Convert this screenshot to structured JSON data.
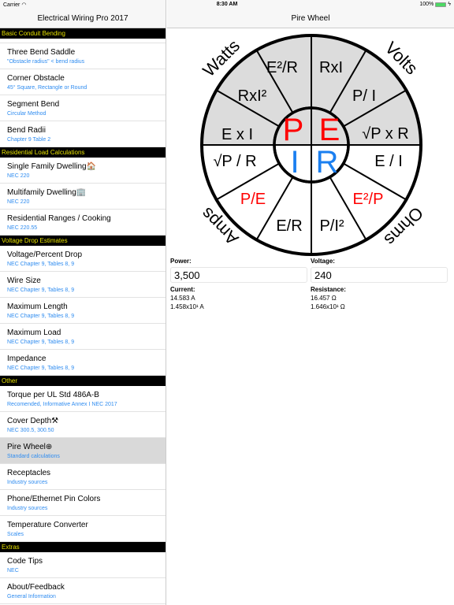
{
  "status": {
    "carrier": "Carrier",
    "time": "8:30 AM",
    "battery": "100%",
    "battery_level": 1.0
  },
  "master": {
    "title": "Electrical Wiring Pro 2017",
    "sections": [
      {
        "header": "Basic Conduit Bending",
        "items": [
          {
            "title": "Three Bend Saddle",
            "subtitle": "\"Obstacle radius\" < bend radius"
          },
          {
            "title": "Corner Obstacle",
            "subtitle": "45° Square, Rectangle or Round"
          },
          {
            "title": "Segment Bend",
            "subtitle": "Circular Method"
          },
          {
            "title": "Bend Radii",
            "subtitle": "Chapter 9 Table 2"
          }
        ]
      },
      {
        "header": "Residential Load Calculations",
        "items": [
          {
            "title": "Single Family Dwelling🏠",
            "subtitle": "NEC 220"
          },
          {
            "title": "Multifamily Dwelling🏢",
            "subtitle": "NEC 220"
          },
          {
            "title": "Residential Ranges / Cooking",
            "subtitle": "NEC 220.55"
          }
        ]
      },
      {
        "header": "Voltage Drop Estimates",
        "items": [
          {
            "title": "Voltage/Percent Drop",
            "subtitle": "NEC Chapter 9, Tables 8, 9"
          },
          {
            "title": "Wire Size",
            "subtitle": "NEC Chapter 9, Tables 8, 9"
          },
          {
            "title": "Maximum Length",
            "subtitle": "NEC Chapter 9, Tables 8, 9"
          },
          {
            "title": "Maximum Load",
            "subtitle": "NEC Chapter 9, Tables 8, 9"
          },
          {
            "title": "Impedance",
            "subtitle": "NEC Chapter 9, Tables 8, 9"
          }
        ]
      },
      {
        "header": "Other",
        "items": [
          {
            "title": "Torque per UL Std 486A-B",
            "subtitle": "Recomended, Informative Annex I NEC 2017"
          },
          {
            "title": "Cover Depth⚒",
            "subtitle": "NEC 300.5, 300.50"
          },
          {
            "title": "Pire Wheel⊕",
            "subtitle": "Standard calculations",
            "selected": true
          },
          {
            "title": "Receptacles",
            "subtitle": "Industry sources"
          },
          {
            "title": "Phone/Ethernet Pin Colors",
            "subtitle": "Industry sources"
          },
          {
            "title": "Temperature Converter",
            "subtitle": "Scales"
          }
        ]
      },
      {
        "header": "Extras",
        "items": [
          {
            "title": "Code Tips",
            "subtitle": "NEC"
          },
          {
            "title": "About/Feedback",
            "subtitle": "General Information"
          }
        ]
      }
    ]
  },
  "detail": {
    "title": "Pire Wheel",
    "wheel": {
      "outer_labels": {
        "watts": "Watts",
        "volts": "Volts",
        "amps": "Amps",
        "ohms": "Ohms"
      },
      "center": {
        "p": "P",
        "e": "E",
        "i": "I",
        "r": "R"
      },
      "colors": {
        "red": "#ff0000",
        "blue": "#1a7ff0",
        "shade": "#dcdcdc"
      },
      "formulas": {
        "p1": "E x I",
        "p2": "RxI²",
        "p3": "E²/R",
        "e1": "RxI",
        "e2": "P/ I",
        "e3": "√P x R",
        "r1": "E / I",
        "r2": "E²/P",
        "r3": "P/I²",
        "i1": "E/R",
        "i2": "P/E",
        "i3": "√P / R"
      }
    },
    "power": {
      "label": "Power:",
      "value": "3,500"
    },
    "voltage": {
      "label": "Voltage:",
      "value": "240"
    },
    "current": {
      "label": "Current:",
      "value": "14.583 A",
      "sci": "1.458x10¹ A"
    },
    "resistance": {
      "label": "Resistance:",
      "value": "16.457 Ω",
      "sci": "1.646x10¹ Ω"
    }
  }
}
